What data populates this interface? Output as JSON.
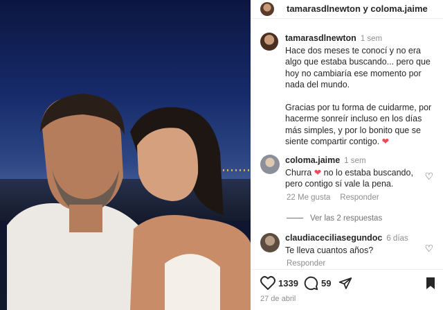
{
  "header": {
    "user1": "tamarasdlnewton",
    "joiner": "y",
    "user2": "coloma.jaime"
  },
  "caption": {
    "username": "tamarasdlnewton",
    "time": "1 sem",
    "paragraph1": "Hace dos meses te conocí y no era algo que estaba buscando... pero que hoy no cambiaría ese momento por nada del mundo.",
    "paragraph2": "Gracias por tu forma de cuidarme, por hacerme sonreír incluso en los días más simples, y por lo bonito que se siente compartir contigo."
  },
  "comments": [
    {
      "username": "coloma.jaime",
      "time": "1 sem",
      "text_before": "Churra",
      "text_after": "no lo estaba buscando, pero contigo sí vale la pena.",
      "likes": "22 Me gusta",
      "reply": "Responder"
    },
    {
      "username": "claudiaceciliasegundoc",
      "time": "6 días",
      "text": "Te lleva cuantos años?",
      "reply": "Responder"
    }
  ],
  "view_replies": "Ver las 2 respuestas",
  "actions": {
    "likes": "1339",
    "comments": "59"
  },
  "date": "27 de abril",
  "colors": {
    "heart": "#ed4956",
    "text": "#262626",
    "muted": "#8e8e8e"
  },
  "icons": [
    "heart-outline-icon",
    "comment-icon",
    "share-icon",
    "bookmark-icon",
    "heart-small-icon"
  ]
}
